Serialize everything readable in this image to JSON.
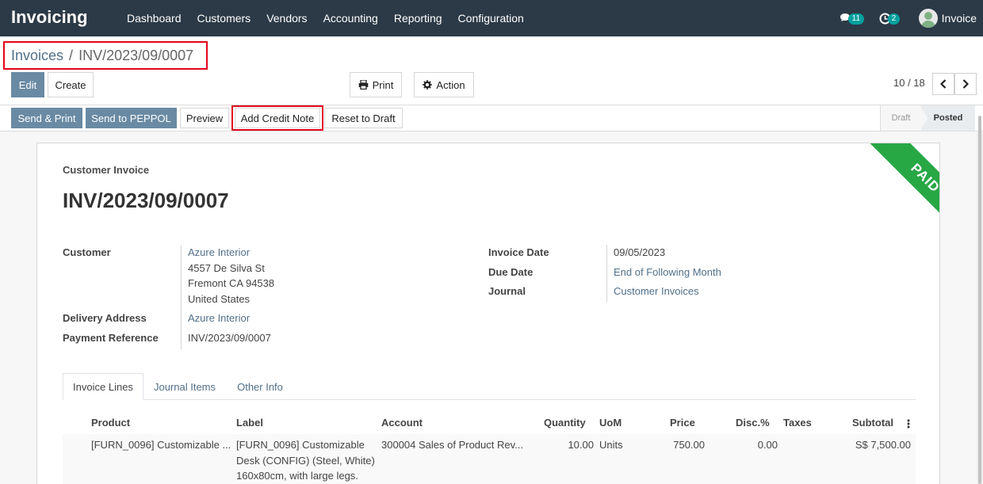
{
  "navbar": {
    "brand": "Invoicing",
    "menu": [
      "Dashboard",
      "Customers",
      "Vendors",
      "Accounting",
      "Reporting",
      "Configuration"
    ],
    "messages_count": "11",
    "activities_count": "2",
    "user_name": "Invoice"
  },
  "breadcrumb": {
    "parent": "Invoices",
    "separator": "/",
    "current": "INV/2023/09/0007"
  },
  "toolbar": {
    "edit": "Edit",
    "create": "Create",
    "print": "Print",
    "action": "Action"
  },
  "pager": {
    "value": "10 / 18"
  },
  "statusbar": {
    "buttons": [
      "Send & Print",
      "Send to PEPPOL",
      "Preview",
      "Add Credit Note",
      "Reset to Draft"
    ],
    "stages": [
      "Draft",
      "Posted"
    ]
  },
  "form": {
    "ribbon": "PAID",
    "doc_type": "Customer Invoice",
    "name": "INV/2023/09/0007",
    "customer_label": "Customer",
    "customer_name": "Azure Interior",
    "customer_address": [
      "4557 De Silva St",
      "Fremont CA 94538",
      "United States"
    ],
    "delivery_label": "Delivery Address",
    "delivery_value": "Azure Interior",
    "payref_label": "Payment Reference",
    "payref_value": "INV/2023/09/0007",
    "invoice_date_label": "Invoice Date",
    "invoice_date_value": "09/05/2023",
    "due_date_label": "Due Date",
    "due_date_value": "End of Following Month",
    "journal_label": "Journal",
    "journal_value": "Customer Invoices"
  },
  "tabs": [
    "Invoice Lines",
    "Journal Items",
    "Other Info"
  ],
  "lines": {
    "columns": [
      "Product",
      "Label",
      "Account",
      "Quantity",
      "UoM",
      "Price",
      "Disc.%",
      "Taxes",
      "Subtotal"
    ],
    "rows": [
      {
        "product": "[FURN_0096] Customizable ...",
        "label": [
          "[FURN_0096] Customizable",
          "Desk (CONFIG) (Steel, White)",
          "160x80cm, with large legs."
        ],
        "account": "300004 Sales of Product Rev...",
        "quantity": "10.00",
        "uom": "Units",
        "price": "750.00",
        "discount": "0.00",
        "taxes": "",
        "subtotal": "S$ 7,500.00"
      }
    ]
  }
}
